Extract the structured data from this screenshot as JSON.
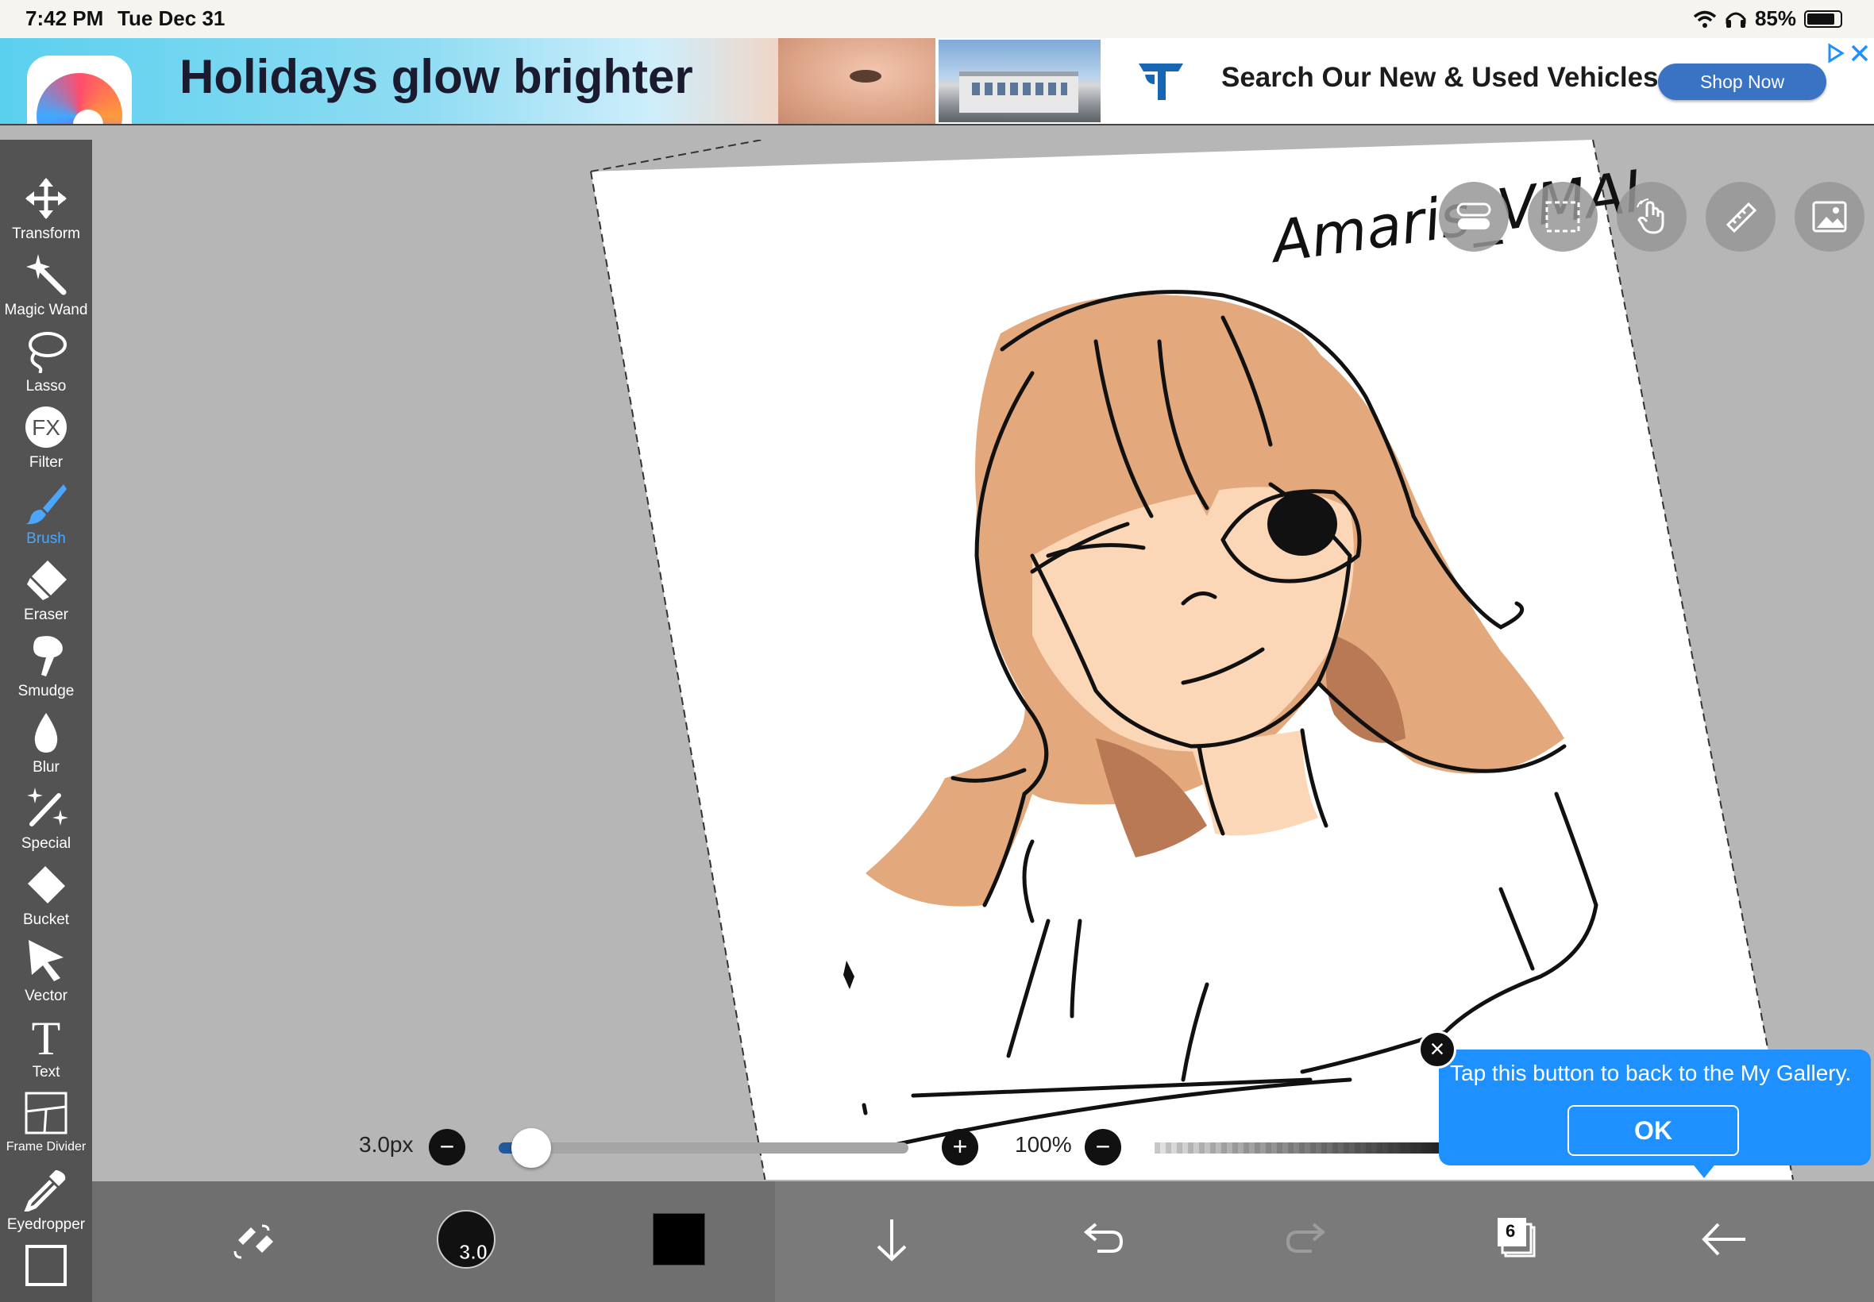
{
  "status_bar": {
    "time": "7:42 PM",
    "date": "Tue Dec 31",
    "battery": "85%",
    "battery_level": 0.85
  },
  "ad": {
    "headline": "Holidays glow brighter",
    "text": "Search Our New & Used Vehicles",
    "cta": "Shop Now"
  },
  "tools": [
    {
      "label": "Transform",
      "icon": "transform-icon"
    },
    {
      "label": "Magic Wand",
      "icon": "magic-wand-icon"
    },
    {
      "label": "Lasso",
      "icon": "lasso-icon"
    },
    {
      "label": "Filter",
      "icon": "filter-fx-icon",
      "glyph": "FX"
    },
    {
      "label": "Brush",
      "icon": "brush-icon",
      "active": true
    },
    {
      "label": "Eraser",
      "icon": "eraser-icon"
    },
    {
      "label": "Smudge",
      "icon": "smudge-icon"
    },
    {
      "label": "Blur",
      "icon": "blur-drop-icon"
    },
    {
      "label": "Special",
      "icon": "special-icon"
    },
    {
      "label": "Bucket",
      "icon": "bucket-icon"
    },
    {
      "label": "Vector",
      "icon": "vector-arrow-icon"
    },
    {
      "label": "Text",
      "icon": "text-icon",
      "glyph": "T"
    },
    {
      "label": "Frame Divider",
      "icon": "frame-divider-icon"
    },
    {
      "label": "Eyedropper",
      "icon": "eyedropper-icon"
    }
  ],
  "canvas": {
    "signature": "Amaris_VMAI"
  },
  "brush_size": {
    "value_label": "3.0px",
    "minus": "−",
    "plus": "+",
    "level": 0.07
  },
  "opacity": {
    "value_label": "100%",
    "minus": "−",
    "level": 1.0
  },
  "bottom_bar": {
    "brush_preview_value": "3.0",
    "current_color": "#000000",
    "layer_count": "6"
  },
  "tooltip": {
    "text": "Tap this button to back to the My Gallery.",
    "ok": "OK",
    "close": "×"
  },
  "colors": {
    "accent": "#1e90ff",
    "active_tool": "#4aa6ff",
    "hair": "#e3a97c",
    "hair_shadow": "#b87954",
    "skin": "#fbd7b8"
  }
}
